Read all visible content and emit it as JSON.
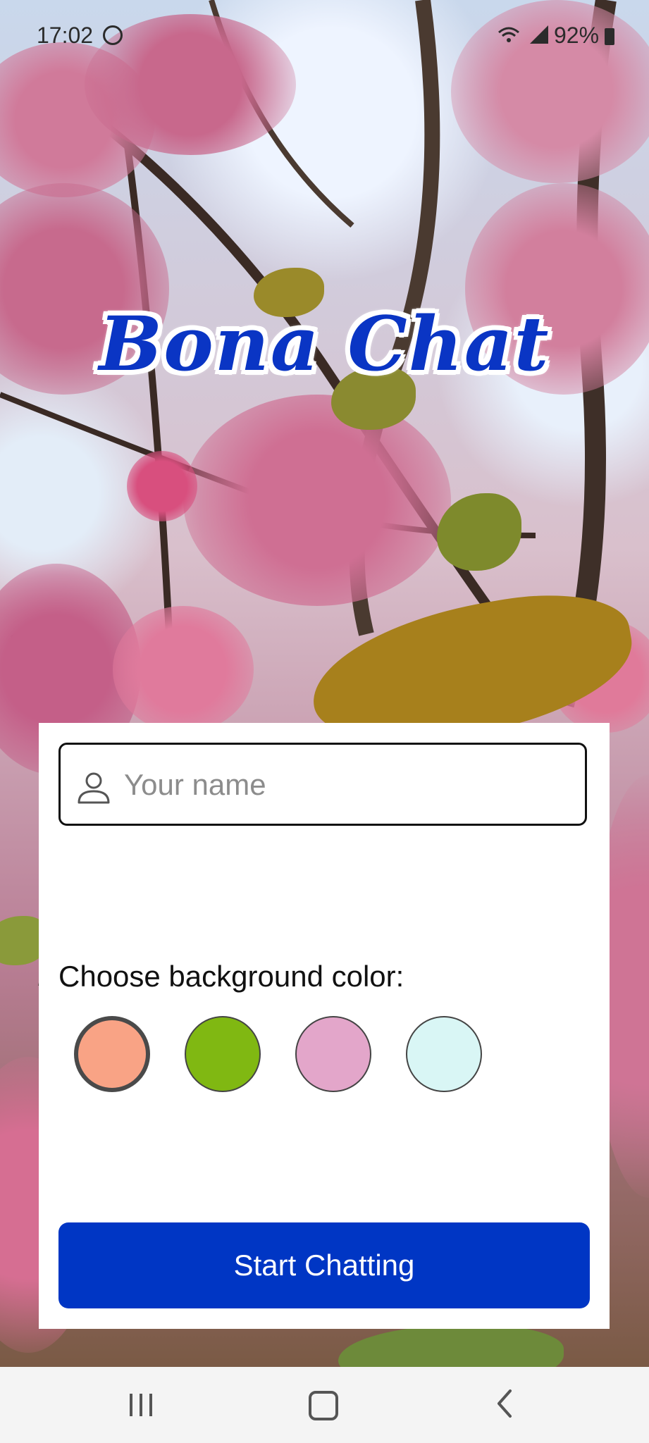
{
  "status_bar": {
    "time": "17:02",
    "battery": "92%",
    "icons": [
      "alarm-icon",
      "wifi-icon",
      "signal-icon",
      "battery-icon"
    ]
  },
  "app": {
    "title": "Bona Chat"
  },
  "form": {
    "name_placeholder": "Your name",
    "name_value": "",
    "name_icon": "person-icon",
    "color_label": "Choose background color:",
    "colors": [
      {
        "name": "salmon",
        "hex": "#F9A385",
        "selected": true
      },
      {
        "name": "green",
        "hex": "#80B812",
        "selected": false
      },
      {
        "name": "pink",
        "hex": "#E3A6CA",
        "selected": false
      },
      {
        "name": "light-cyan",
        "hex": "#D9F6F5",
        "selected": false
      }
    ],
    "start_button_label": "Start Chatting",
    "start_button_color": "#0036C4"
  },
  "nav_bar": {
    "icons": [
      "recent-apps-icon",
      "home-icon",
      "back-icon"
    ]
  }
}
